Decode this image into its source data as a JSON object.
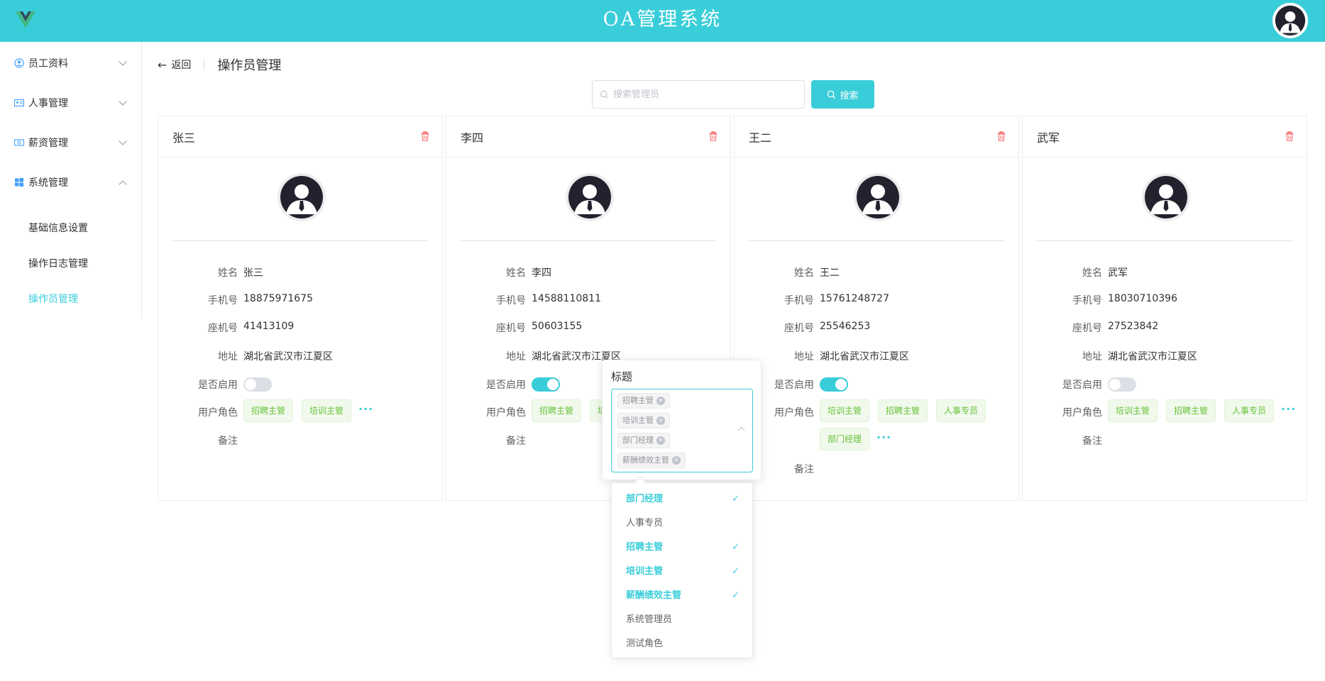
{
  "header": {
    "title": "OA管理系统"
  },
  "sidebar": {
    "items": [
      {
        "label": "员工资料",
        "icon": "user-circle-icon",
        "expanded": false
      },
      {
        "label": "人事管理",
        "icon": "id-card-icon",
        "expanded": false
      },
      {
        "label": "薪资管理",
        "icon": "money-icon",
        "expanded": false
      },
      {
        "label": "系统管理",
        "icon": "windows-icon",
        "expanded": true
      }
    ],
    "subitems": [
      {
        "label": "基础信息设置",
        "active": false
      },
      {
        "label": "操作日志管理",
        "active": false
      },
      {
        "label": "操作员管理",
        "active": true
      }
    ]
  },
  "page": {
    "back_label": "返回",
    "title": "操作员管理"
  },
  "search": {
    "placeholder": "搜索管理员",
    "button_label": "搜索"
  },
  "labels": {
    "name": "姓名",
    "phone": "手机号",
    "tel": "座机号",
    "address": "地址",
    "enabled": "是否启用",
    "roles": "用户角色",
    "remark": "备注"
  },
  "cards": [
    {
      "title": "张三",
      "name": "张三",
      "phone": "18875971675",
      "tel": "41413109",
      "address": "湖北省武汉市江夏区",
      "enabled": false,
      "roles": [
        "招聘主管",
        "培训主管"
      ],
      "more": "···"
    },
    {
      "title": "李四",
      "name": "李四",
      "phone": "14588110811",
      "tel": "50603155",
      "address": "湖北省武汉市江夏区",
      "enabled": true,
      "roles": [
        "招聘主管",
        "培",
        "薪酬绩效主管"
      ]
    },
    {
      "title": "王二",
      "name": "王二",
      "phone": "15761248727",
      "tel": "25546253",
      "address": "湖北省武汉市江夏区",
      "enabled": true,
      "roles": [
        "培训主管",
        "招聘主管",
        "人事专员",
        "部门经理"
      ],
      "more": "···"
    },
    {
      "title": "武军",
      "name": "武军",
      "phone": "18030710396",
      "tel": "27523842",
      "address": "湖北省武汉市江夏区",
      "enabled": false,
      "roles": [
        "培训主管",
        "招聘主管",
        "人事专员"
      ],
      "more": "···"
    }
  ],
  "popover": {
    "title": "标题",
    "selected_tags": [
      "招聘主管",
      "培训主管",
      "部门经理",
      "薪酬绩效主管"
    ]
  },
  "dropdown": {
    "options": [
      {
        "label": "部门经理",
        "selected": true
      },
      {
        "label": "人事专员",
        "selected": false
      },
      {
        "label": "招聘主管",
        "selected": true
      },
      {
        "label": "培训主管",
        "selected": true
      },
      {
        "label": "薪酬绩效主管",
        "selected": true
      },
      {
        "label": "系统管理员",
        "selected": false
      },
      {
        "label": "测试角色",
        "selected": false
      }
    ],
    "check_mark": "✓"
  },
  "colors": {
    "primary": "#39cdd9",
    "danger": "#f56c6c",
    "tag_green": "#67c23a"
  }
}
